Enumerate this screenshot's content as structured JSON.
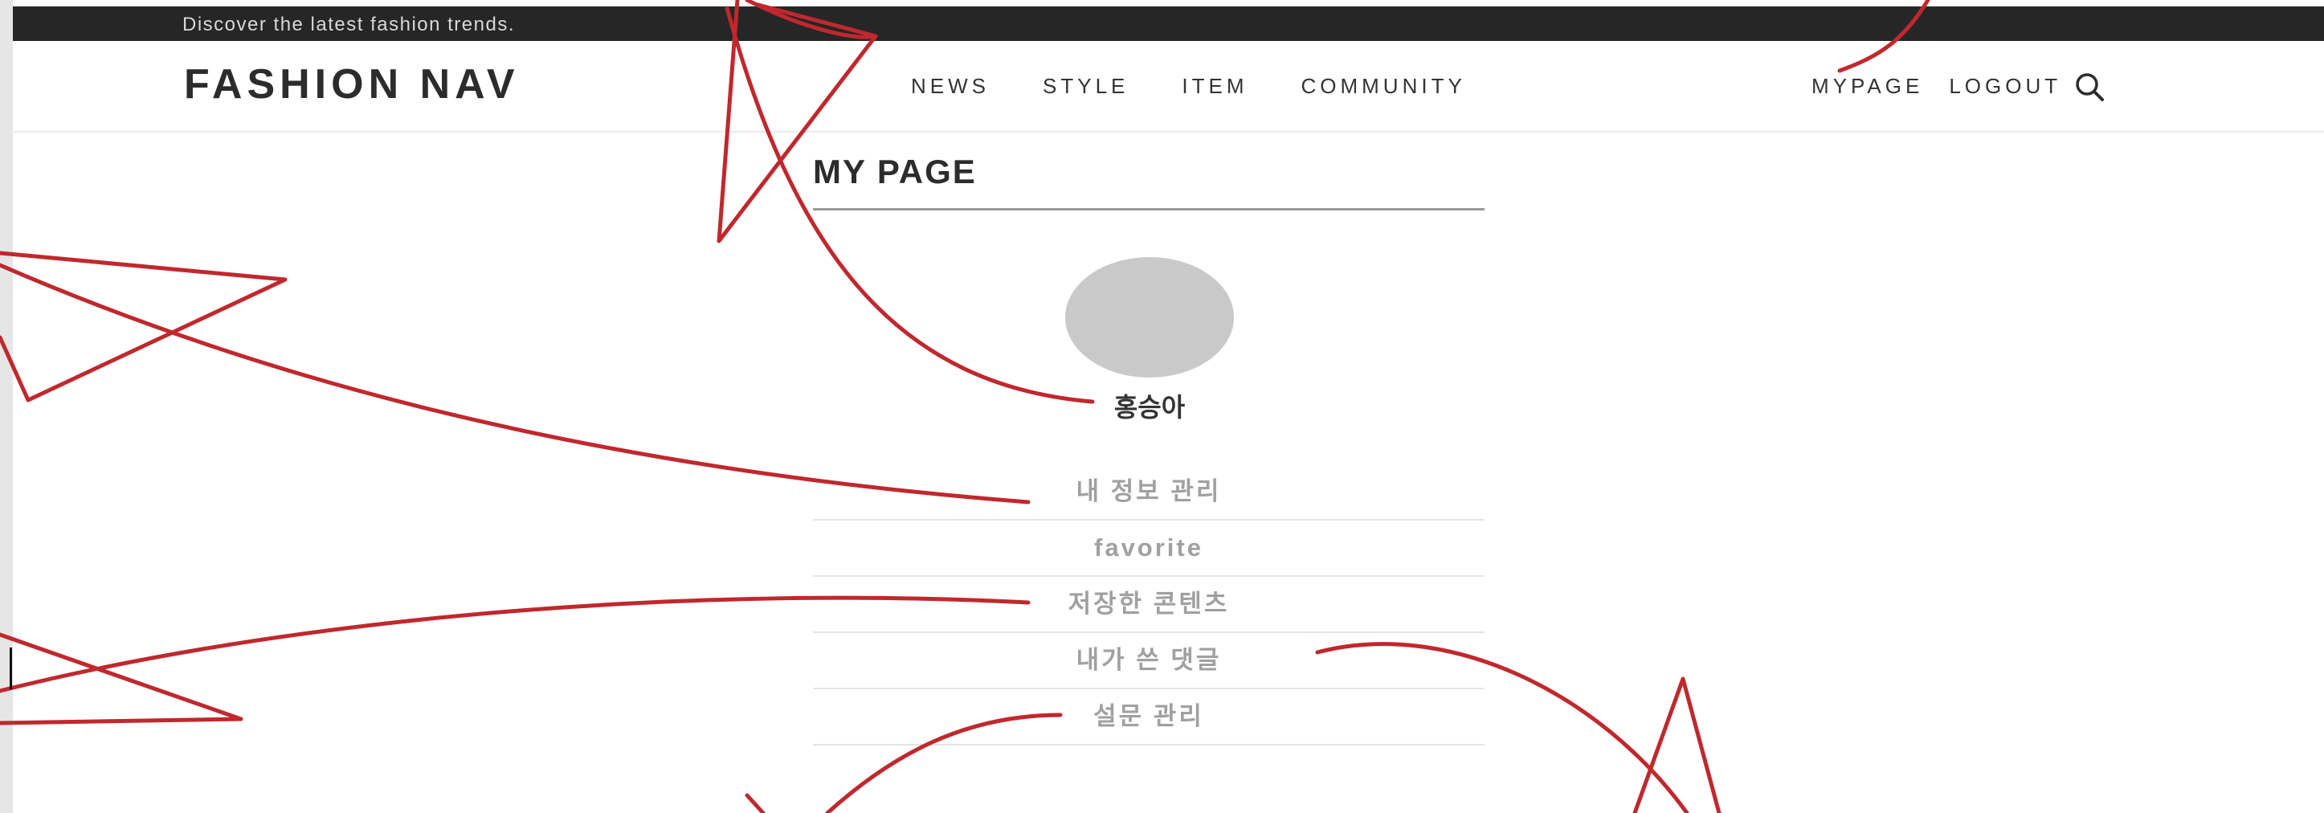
{
  "topbar": {
    "notice": "Discover the latest fashion trends."
  },
  "header": {
    "logo": "FASHION NAV",
    "nav": [
      "NEWS",
      "STYLE",
      "ITEM",
      "COMMUNITY"
    ],
    "util": {
      "mypage": "MYPAGE",
      "logout": "LOGOUT"
    },
    "search_icon": "search-icon"
  },
  "main": {
    "title": "MY PAGE",
    "user_name": "홍승아",
    "menu": [
      "내 정보 관리",
      "favorite",
      "저장한 콘텐츠",
      "내가 쓴 댓글",
      "설문 관리"
    ]
  },
  "colors": {
    "topbar_bg": "#262626",
    "menu_text": "#a0a0a0",
    "scribble": "#c0282d",
    "avatar": "#c9c9c9"
  }
}
